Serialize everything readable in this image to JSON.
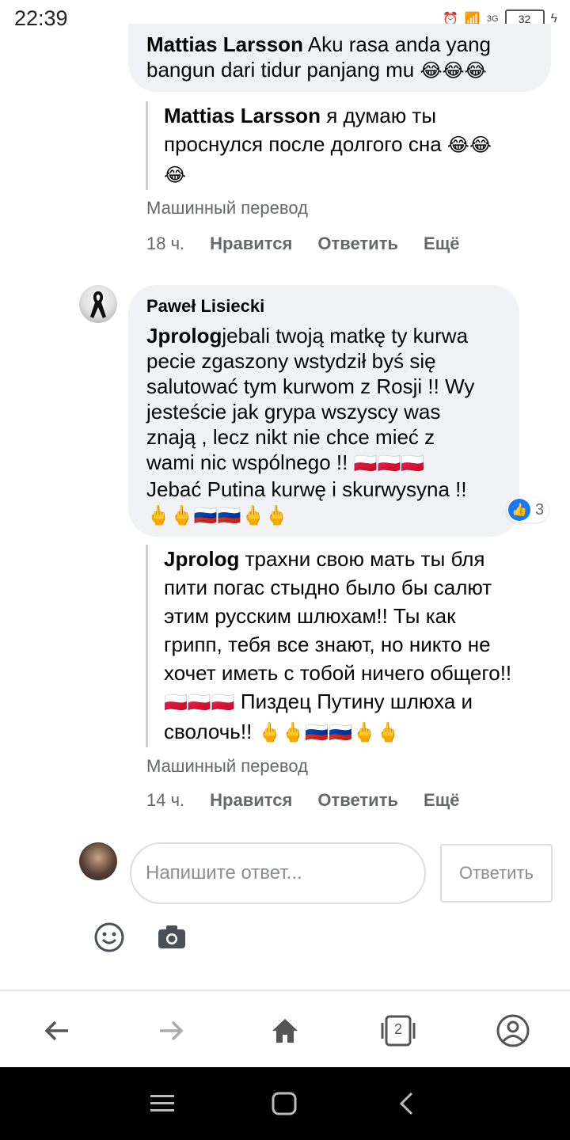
{
  "status_bar": {
    "time": "22:39",
    "network": "3G",
    "battery": "32"
  },
  "prev_comment": {
    "author": "Mattias Larsson",
    "text_line1": "Aku rasa anda yang",
    "text_line2": "bangun dari tidur panjang mu",
    "emojis": "😂😂😂",
    "translation_author": "Mattias Larsson",
    "translation_line1": "я думаю ты",
    "translation_line2": "проснулся после долгого сна",
    "translation_emojis_line2": "😂😂",
    "translation_emojis_line3": "😂",
    "machine_translation": "Машинный перевод",
    "time": "18 ч.",
    "like": "Нравится",
    "reply": "Ответить",
    "more": "Ещё"
  },
  "comment": {
    "author": "Paweł Lisiecki",
    "mention": "Jprolog",
    "lines": [
      "jebali twoją matkę ty kurwa",
      "pecie zgaszony wstydził byś się",
      "salutować tym kurwom z Rosji !! Wy",
      "jesteście jak grypa wszyscy was",
      "znają , lecz nikt nie chce mieć z",
      "wami nic wspólnego !!",
      "Jebać Putina kurwę i skurwysyna !!"
    ],
    "flags_pl": "🇵🇱🇵🇱🇵🇱",
    "emoji_line": "🖕🖕🇷🇺🇷🇺🖕🖕",
    "like_count": "3",
    "translation_mention": "Jprolog",
    "translation_lines": [
      "трахни свою мать ты бля",
      "пити погас стыдно было бы салют",
      "этим русским шлюхам!! Ты как",
      "грипп, тебя все знают, но никто не",
      "хочет иметь с тобой ничего общего!!",
      "Пиздец Путину шлюха и",
      "сволочь!!"
    ],
    "translation_flags_pl": "🇵🇱🇵🇱🇵🇱",
    "translation_emoji_line": "🖕🖕🇷🇺🇷🇺🖕🖕",
    "machine_translation": "Машинный перевод",
    "time": "14 ч.",
    "like": "Нравится",
    "reply": "Ответить",
    "more": "Ещё"
  },
  "reply_box": {
    "placeholder": "Напишите ответ...",
    "submit": "Ответить"
  },
  "bottom_nav": {
    "tabs_count": "2"
  },
  "colors": {
    "accent": "#1877f2",
    "bubble": "#f0f2f5",
    "gray_text": "#65676b"
  }
}
